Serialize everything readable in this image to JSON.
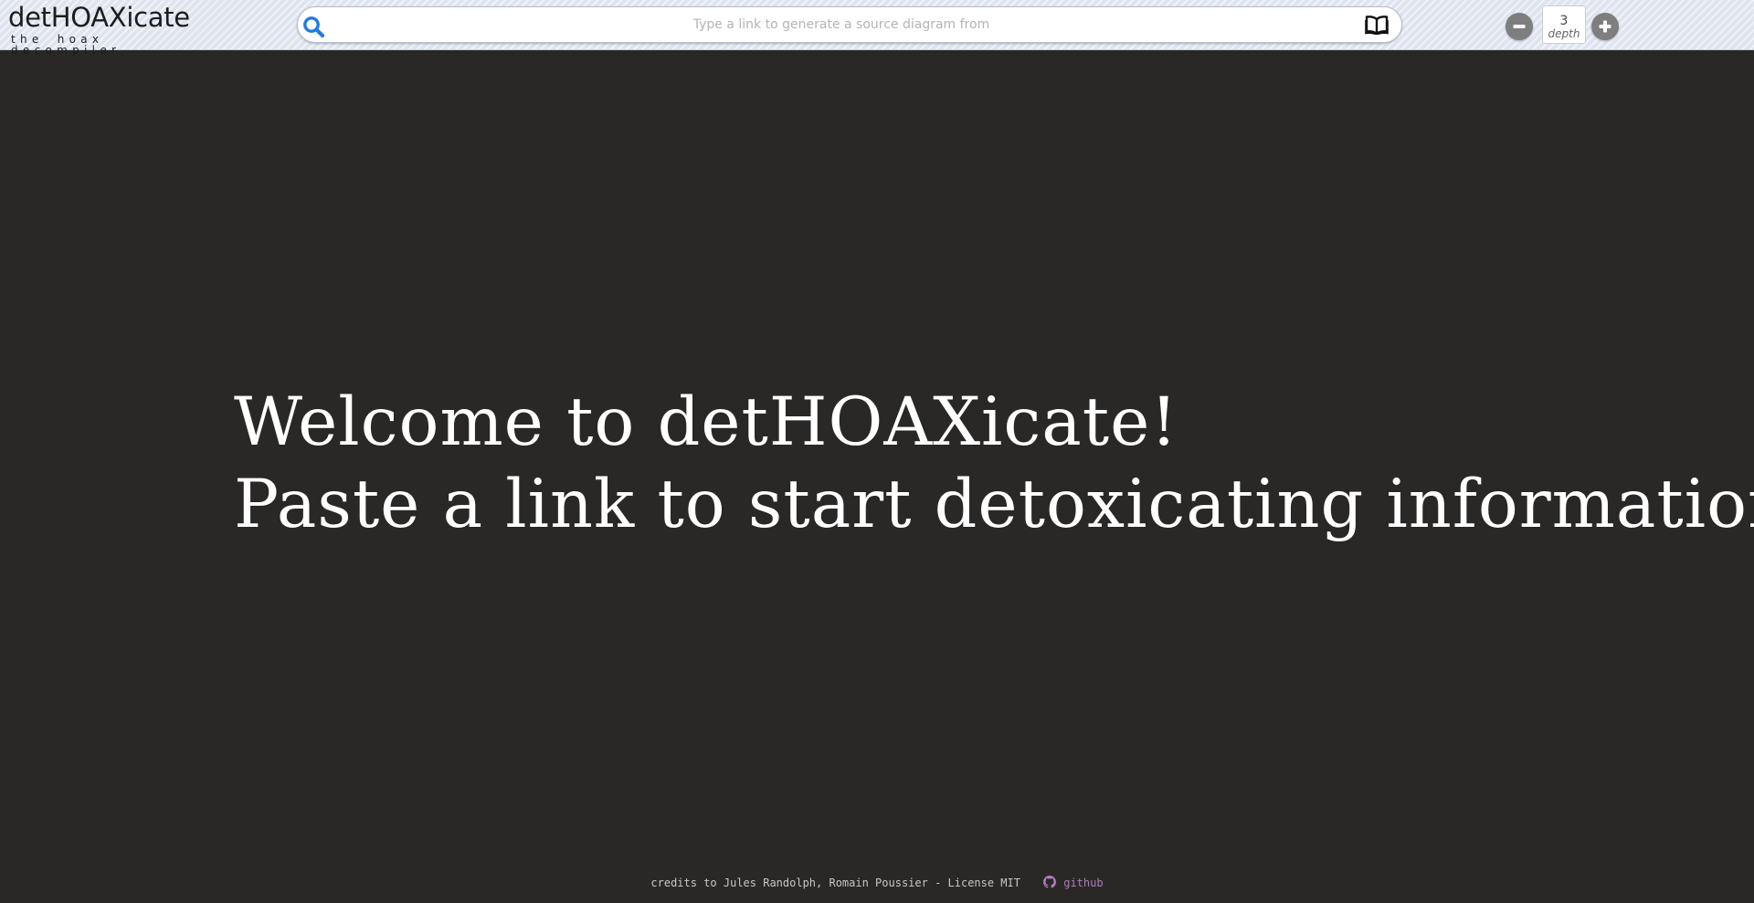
{
  "header": {
    "logo_title": "detHOAXicate",
    "logo_subtitle": "the hoax decompiler",
    "search": {
      "placeholder": "Type a link to generate a source diagram from",
      "value": ""
    },
    "depth": {
      "value": "3",
      "label": "depth"
    },
    "icons": {
      "search": "search-icon",
      "book": "open-book-icon",
      "minus": "minus-icon",
      "plus": "plus-icon"
    }
  },
  "main": {
    "welcome_line1": "Welcome to detHOAXicate!",
    "welcome_line2": "Paste a link to start detoxicating information"
  },
  "footer": {
    "credits": "credits to Jules Randolph, Romain Poussier - License MIT",
    "github_label": "github",
    "github_icon": "github-icon"
  },
  "colors": {
    "background": "#292827",
    "header_background": "#dfe4ef",
    "search_icon": "#1f7be0",
    "button_grey": "#7e7e7e",
    "link_purple": "#b07cb9",
    "text_white": "#ffffff"
  }
}
